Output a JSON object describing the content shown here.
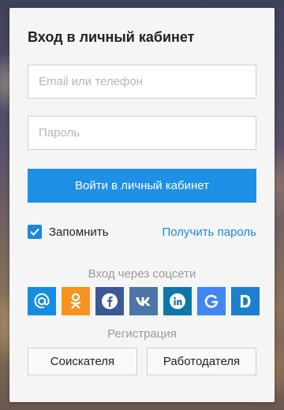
{
  "login": {
    "title": "Вход в личный кабинет",
    "email_placeholder": "Email или телефон",
    "email_value": "",
    "password_placeholder": "Пароль",
    "password_value": "",
    "submit_label": "Войти в личный кабинет",
    "remember_label": "Запомнить",
    "remember_checked": true,
    "get_password_label": "Получить пароль"
  },
  "social": {
    "title": "Вход через соцсети",
    "items": [
      {
        "name": "mail-ru-icon",
        "color": "#168de2"
      },
      {
        "name": "odnoklassniki-icon",
        "color": "#f7931e"
      },
      {
        "name": "facebook-icon",
        "color": "#3b5998"
      },
      {
        "name": "vk-icon",
        "color": "#4a76a8"
      },
      {
        "name": "linkedin-icon",
        "color": "#0e76a8"
      },
      {
        "name": "google-icon",
        "color": "#4285f4"
      },
      {
        "name": "d-icon",
        "color": "#1e7fd0"
      }
    ]
  },
  "registration": {
    "title": "Регистрация",
    "seeker_label": "Соискателя",
    "employer_label": "Работодателя"
  },
  "colors": {
    "primary": "#1e90e6",
    "link": "#1e88d8"
  }
}
